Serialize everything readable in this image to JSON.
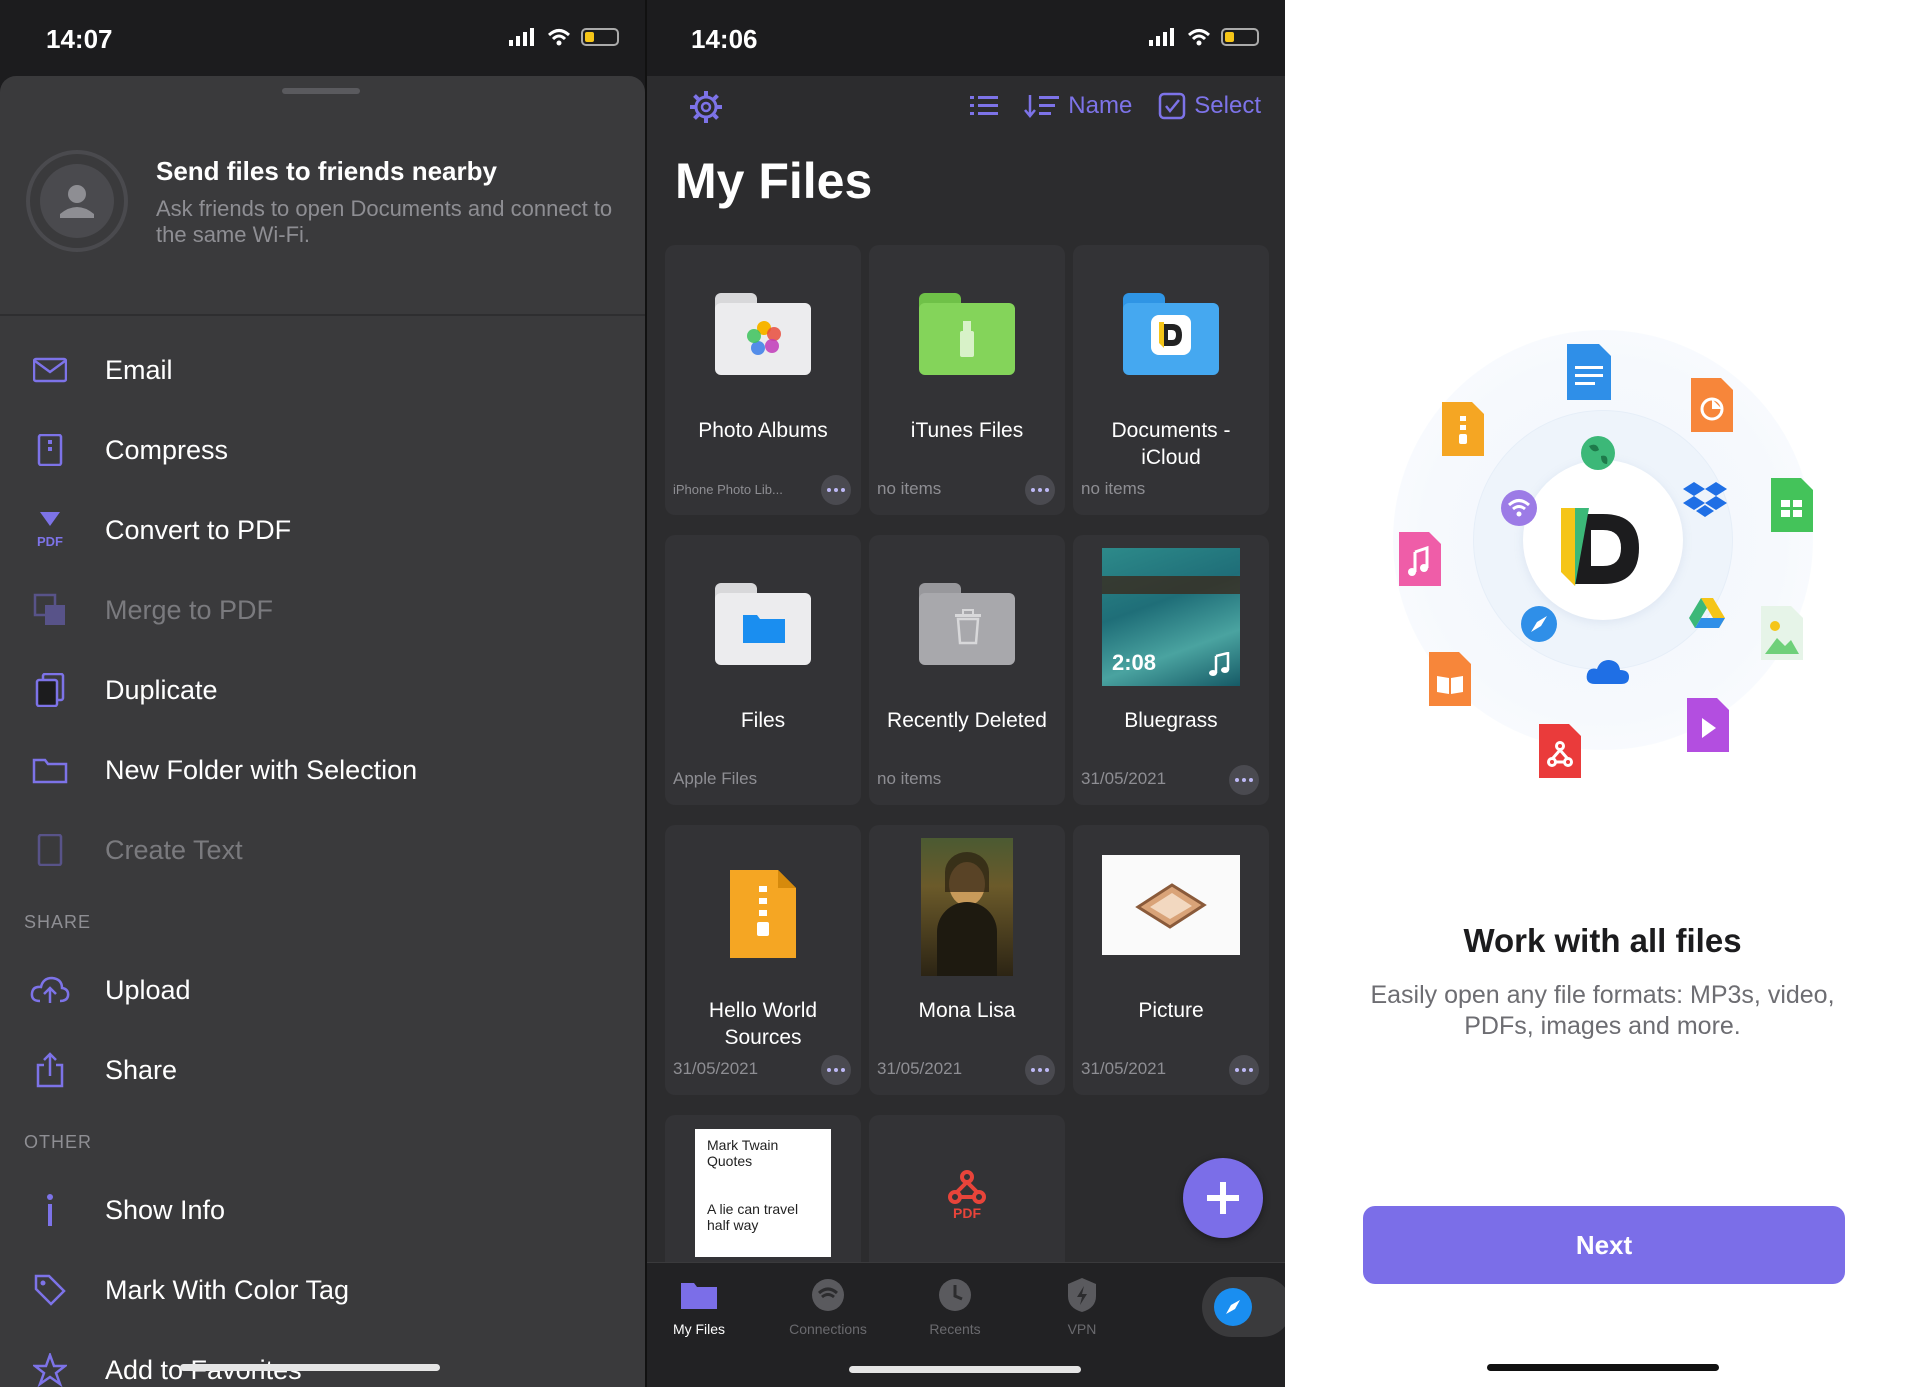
{
  "left": {
    "status_time": "14:07",
    "nearby_title": "Send files to friends nearby",
    "nearby_subtitle": "Ask friends to open Documents and connect to the same Wi-Fi.",
    "menu": [
      {
        "label": "Email",
        "icon": "mail-icon",
        "disabled": false
      },
      {
        "label": "Compress",
        "icon": "archive-icon",
        "disabled": false
      },
      {
        "label": "Convert to PDF",
        "icon": "pdf-convert-icon",
        "disabled": false
      },
      {
        "label": "Merge to PDF",
        "icon": "merge-icon",
        "disabled": true
      },
      {
        "label": "Duplicate",
        "icon": "duplicate-icon",
        "disabled": false
      },
      {
        "label": "New Folder with Selection",
        "icon": "folder-icon",
        "disabled": false
      },
      {
        "label": "Create Text",
        "icon": "text-file-icon",
        "disabled": true
      }
    ],
    "share_section": "SHARE",
    "share": [
      {
        "label": "Upload",
        "icon": "upload-cloud-icon"
      },
      {
        "label": "Share",
        "icon": "share-icon"
      }
    ],
    "other_section": "OTHER",
    "other": [
      {
        "label": "Show Info",
        "icon": "info-icon"
      },
      {
        "label": "Mark With Color Tag",
        "icon": "tag-icon"
      },
      {
        "label": "Add to Favorites",
        "icon": "star-icon"
      }
    ],
    "pdf_badge": "PDF"
  },
  "middle": {
    "status_time": "14:06",
    "sort_label": "Name",
    "select_label": "Select",
    "title": "My Files",
    "tiles": [
      {
        "name": "Photo Albums",
        "meta": "iPhone Photo Lib..."
      },
      {
        "name": "iTunes Files",
        "meta": "no items"
      },
      {
        "name": "Documents - iCloud",
        "meta": "no items"
      },
      {
        "name": "Files",
        "meta": "Apple Files"
      },
      {
        "name": "Recently Deleted",
        "meta": "no items"
      },
      {
        "name": "Bluegrass",
        "meta": "31/05/2021",
        "duration": "2:08"
      },
      {
        "name": "Hello World Sources",
        "meta": "31/05/2021"
      },
      {
        "name": "Mona Lisa",
        "meta": "31/05/2021"
      },
      {
        "name": "Picture",
        "meta": "31/05/2021"
      },
      {
        "name": "",
        "meta": "",
        "doc_line1": "Mark Twain Quotes",
        "doc_line2": "A lie can travel half way"
      },
      {
        "name": "",
        "meta": "",
        "badge": "PDF"
      }
    ],
    "tabs": [
      {
        "label": "My Files",
        "icon": "folder-icon",
        "active": true
      },
      {
        "label": "Connections",
        "icon": "connections-icon",
        "active": false
      },
      {
        "label": "Recents",
        "icon": "clock-icon",
        "active": false
      },
      {
        "label": "VPN",
        "icon": "shield-icon",
        "active": false
      }
    ]
  },
  "right": {
    "title": "Work with all files",
    "subtitle": "Easily open any file formats: MP3s, video, PDFs, images and more.",
    "next_label": "Next"
  },
  "colors": {
    "accent": "#7b6ee8",
    "dark_bg": "#2c2c2e",
    "sheet_bg": "#3a3a3c"
  }
}
